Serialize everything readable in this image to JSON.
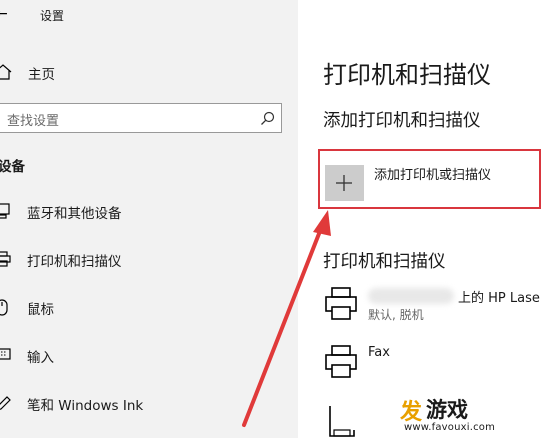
{
  "window": {
    "app_title": "设置"
  },
  "sidebar": {
    "home_label": "主页",
    "search_placeholder": "查找设置",
    "section_label": "设备",
    "items": [
      {
        "label": "蓝牙和其他设备",
        "icon": "bluetooth-devices-icon"
      },
      {
        "label": "打印机和扫描仪",
        "icon": "printer-icon"
      },
      {
        "label": "鼠标",
        "icon": "mouse-icon"
      },
      {
        "label": "输入",
        "icon": "keyboard-icon"
      },
      {
        "label": "笔和 Windows Ink",
        "icon": "pen-icon"
      }
    ]
  },
  "main": {
    "page_title": "打印机和扫描仪",
    "add_section_heading": "添加打印机和扫描仪",
    "add_button_label": "添加打印机或扫描仪",
    "devices_heading": "打印机和扫描仪",
    "devices": [
      {
        "name": "上的 HP Lase",
        "status": "默认, 脱机",
        "icon": "printer-icon"
      },
      {
        "name": "Fax",
        "status": "",
        "icon": "printer-icon"
      }
    ]
  },
  "watermark": {
    "logo": "发",
    "text": "游戏",
    "url": "www.favouxi.com"
  },
  "colors": {
    "highlight": "#d9363e",
    "sidebar_bg": "#f2f2f2",
    "watermark_orange": "#e8a000"
  }
}
